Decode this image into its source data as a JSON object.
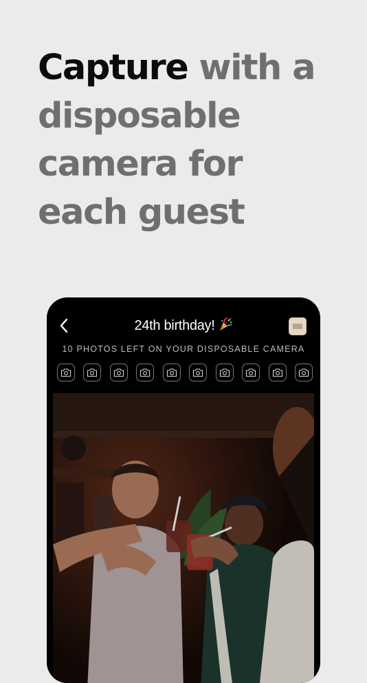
{
  "headline": {
    "strong": "Capture",
    "rest": "with a disposable camera for each guest"
  },
  "event": {
    "title": "24th birthday!",
    "title_emoji_icon": "party-popper-icon",
    "back_icon": "chevron-left-icon",
    "photos_left_label": "10 PHOTOS LEFT ON YOUR DISPOSABLE CAMERA",
    "photos_left_count": 10,
    "shot_icon": "camera-icon"
  },
  "photo": {
    "subject": "party-guests-toasting-photo"
  },
  "colors": {
    "background": "#ebebeb",
    "headline_strong": "#0b0b0b",
    "headline_rest": "#6f6f6f",
    "phone": "#000000",
    "subtitle": "#bdbdbd"
  }
}
